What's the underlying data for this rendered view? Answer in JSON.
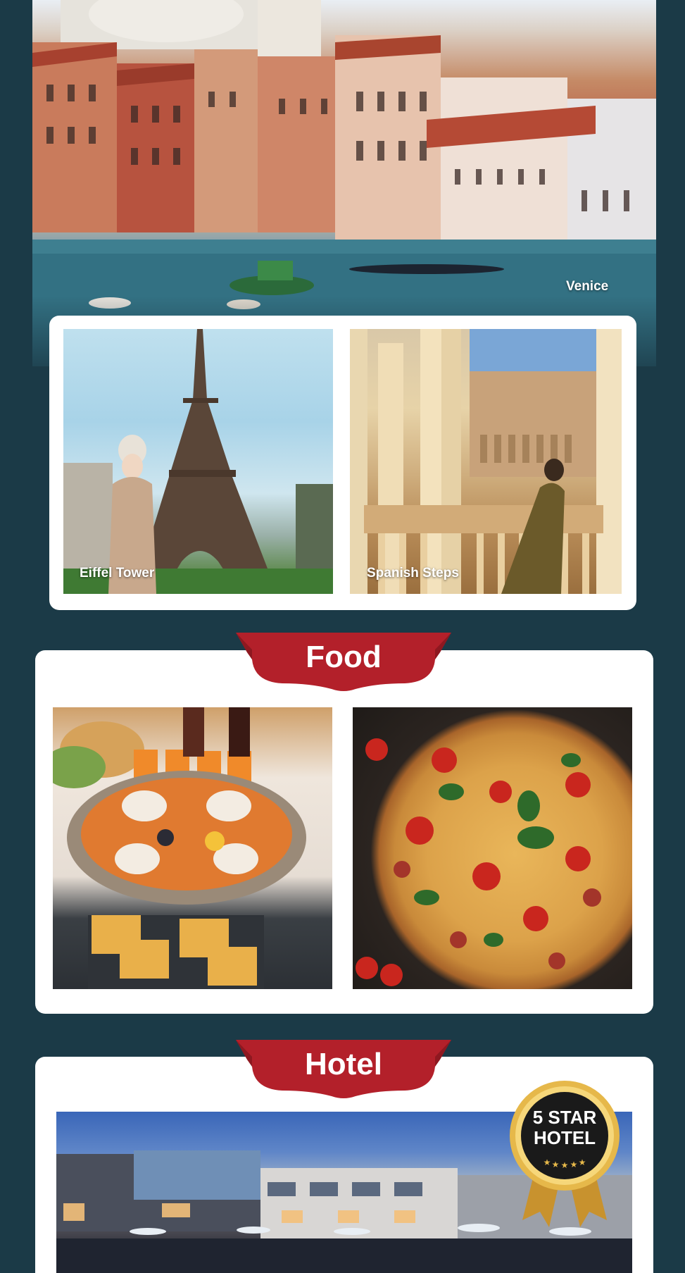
{
  "gallery": {
    "venice_caption": "Venice",
    "eiffel_caption": "Eiffel Tower",
    "spanish_caption": "Spanish Steps"
  },
  "sections": {
    "food_title": "Food",
    "hotel_title": "Hotel"
  },
  "badge": {
    "line1": "5 STAR",
    "line2": "HOTEL"
  },
  "colors": {
    "background": "#1b3a47",
    "ribbon": "#b3202a",
    "card": "#ffffff",
    "badge_gold": "#d4a63a"
  }
}
